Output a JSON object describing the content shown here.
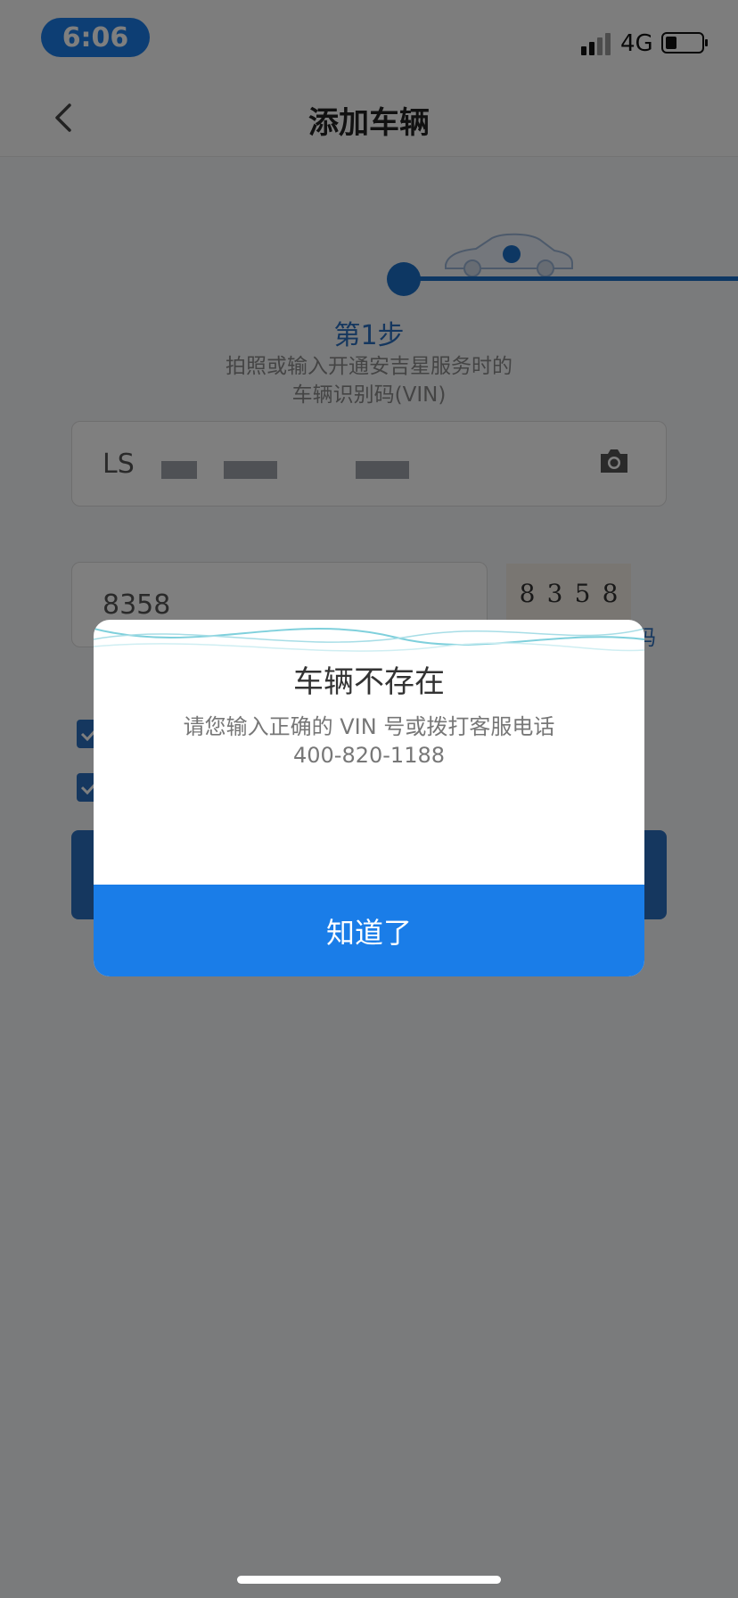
{
  "status_bar": {
    "time": "6:06",
    "network": "4G"
  },
  "nav": {
    "title": "添加车辆"
  },
  "step": {
    "title": "第1步",
    "desc_line1": "拍照或输入开通安吉星服务时的",
    "desc_line2": "车辆识别码(VIN)"
  },
  "vin_field": {
    "value": "LS"
  },
  "code_field": {
    "value": "8358"
  },
  "captcha": {
    "digits": [
      "8",
      "3",
      "5",
      "8"
    ]
  },
  "refresh": {
    "label": "码"
  },
  "dialog": {
    "title": "车辆不存在",
    "message_line1": "请您输入正确的 VIN 号或拨打客服电话",
    "message_line2": "400-820-1188",
    "button_label": "知道了"
  },
  "colors": {
    "primary": "#1a7de8",
    "brand": "#2b6fbf",
    "overlay": "rgba(0,0,0,0.5)"
  }
}
